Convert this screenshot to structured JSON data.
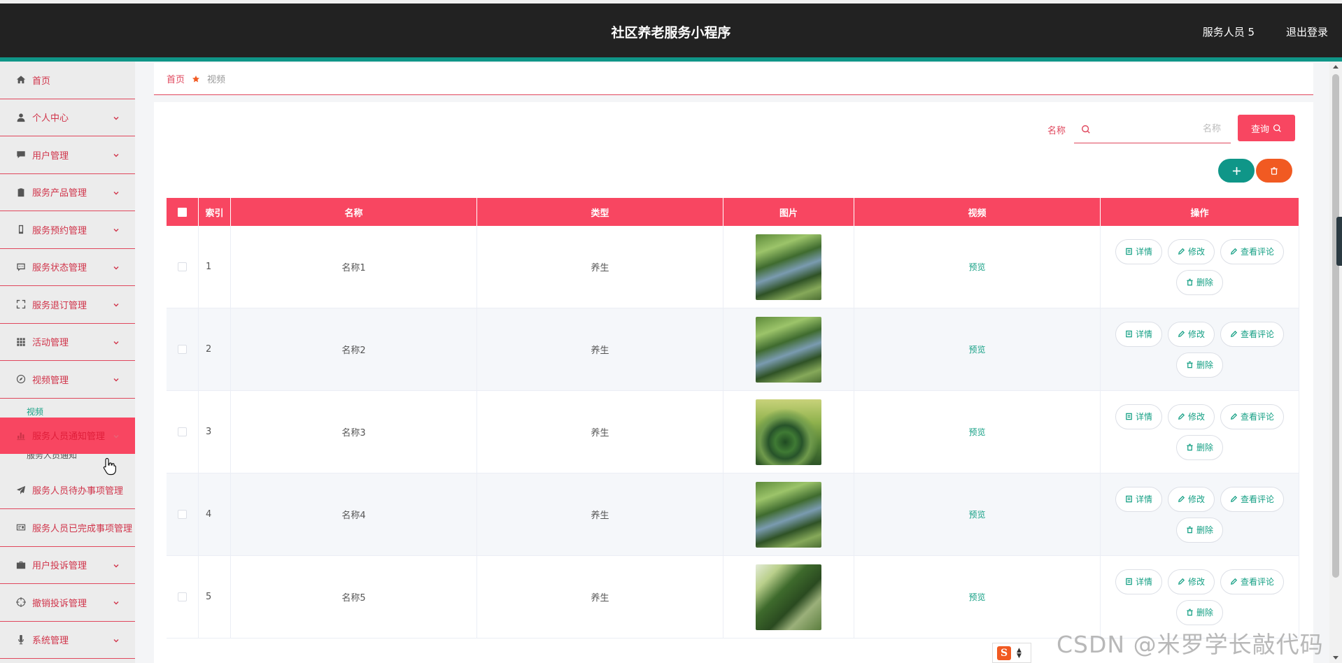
{
  "header": {
    "title": "社区养老服务小程序",
    "user": "服务人员 5",
    "logout": "退出登录"
  },
  "sidebar": {
    "items": [
      {
        "label": "首页",
        "icon": "home-icon",
        "chevron": false
      },
      {
        "label": "个人中心",
        "icon": "user-icon",
        "chevron": true
      },
      {
        "label": "用户管理",
        "icon": "chat-icon",
        "chevron": true
      },
      {
        "label": "服务产品管理",
        "icon": "clipboard-icon",
        "chevron": true
      },
      {
        "label": "服务预约管理",
        "icon": "mobile-icon",
        "chevron": true
      },
      {
        "label": "服务状态管理",
        "icon": "message-icon",
        "chevron": true
      },
      {
        "label": "服务退订管理",
        "icon": "fullscreen-icon",
        "chevron": true
      },
      {
        "label": "活动管理",
        "icon": "grid-icon",
        "chevron": true
      },
      {
        "label": "视频管理",
        "icon": "compass-icon",
        "chevron": true
      }
    ],
    "video_sub": "视频",
    "active_item": "服务人员通知管理",
    "hidden_sub": "服务人员通知",
    "items_after": [
      {
        "label": "服务人员待办事项管理",
        "icon": "send-icon",
        "chevron": false
      },
      {
        "label": "服务人员已完成事项管理",
        "icon": "card-icon",
        "chevron": false
      },
      {
        "label": "用户投诉管理",
        "icon": "suitcase-icon",
        "chevron": true
      },
      {
        "label": "撤销投诉管理",
        "icon": "target-icon",
        "chevron": true
      },
      {
        "label": "系统管理",
        "icon": "mic-icon",
        "chevron": true
      }
    ]
  },
  "breadcrumb": {
    "home": "首页",
    "current": "视频"
  },
  "search": {
    "label": "名称",
    "placeholder": "名称",
    "button": "查询"
  },
  "table": {
    "headers": [
      "索引",
      "名称",
      "类型",
      "图片",
      "视频",
      "操作"
    ],
    "rows": [
      {
        "index": "1",
        "name": "名称1",
        "type": "养生",
        "video": "预览",
        "img": "park"
      },
      {
        "index": "2",
        "name": "名称2",
        "type": "养生",
        "video": "预览",
        "img": "park"
      },
      {
        "index": "3",
        "name": "名称3",
        "type": "养生",
        "video": "预览",
        "img": "maze"
      },
      {
        "index": "4",
        "name": "名称4",
        "type": "养生",
        "video": "预览",
        "img": "park"
      },
      {
        "index": "5",
        "name": "名称5",
        "type": "养生",
        "video": "预览",
        "img": "path"
      }
    ],
    "actions": {
      "detail": "详情",
      "edit": "修改",
      "comments": "查看评论",
      "delete": "删除"
    }
  },
  "colors": {
    "primary": "#f84661",
    "teal": "#0f9688",
    "orange": "#f15a22",
    "header_bg": "#222222"
  },
  "watermark": "CSDN @米罗学长敲代码"
}
